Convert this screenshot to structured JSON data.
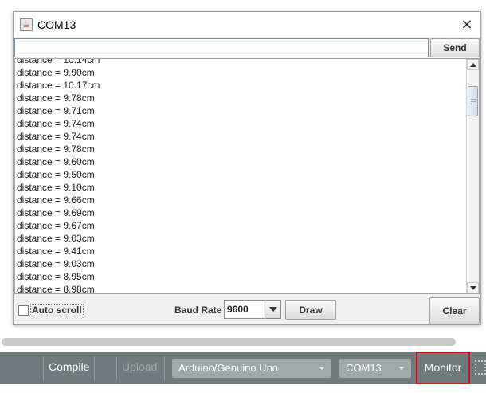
{
  "window": {
    "title": "COM13",
    "close_label": "×"
  },
  "send": {
    "input_value": "",
    "button_label": "Send"
  },
  "output": {
    "lines": [
      "distance = 10.14cm",
      "distance = 9.90cm",
      "distance = 10.17cm",
      "distance = 9.78cm",
      "distance = 9.71cm",
      "distance = 9.74cm",
      "distance = 9.74cm",
      "distance = 9.78cm",
      "distance = 9.60cm",
      "distance = 9.50cm",
      "distance = 9.10cm",
      "distance = 9.66cm",
      "distance = 9.69cm",
      "distance = 9.67cm",
      "distance = 9.03cm",
      "distance = 9.41cm",
      "distance = 9.03cm",
      "distance = 8.95cm",
      "distance = 8.98cm"
    ]
  },
  "controls": {
    "autoscroll_label": "Auto scroll",
    "autoscroll_checked": false,
    "baud_label": "Baud Rate",
    "baud_value": "9600",
    "draw_label": "Draw",
    "clear_label": "Clear"
  },
  "toolbar": {
    "compile_label": "Compile",
    "upload_label": "Upload",
    "board": "Arduino/Genuino Uno",
    "port": "COM13",
    "monitor_label": "Monitor",
    "highlight_color": "#d0141e"
  }
}
